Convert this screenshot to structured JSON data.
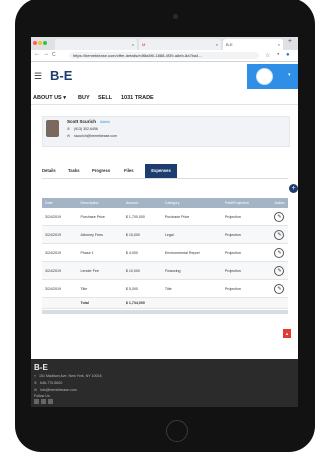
{
  "browser": {
    "tabs": [
      {
        "label": ""
      },
      {
        "label": "M"
      },
      {
        "label": "B-E"
      }
    ],
    "tab_close": "×",
    "new_tab": "+",
    "nav": {
      "back": "←",
      "forward": "→",
      "reload": "C"
    },
    "url": "https://bemebiease.com/offer-details/e4f8a5f0-1888-4f39-a8eb-8a7ba4..."
  },
  "site": {
    "logo": "B-E",
    "menu_icon": "hamburger-icon",
    "nav": [
      "ABOUT US ▾",
      "BUY",
      "SELL",
      "1031 TRADE"
    ]
  },
  "agent": {
    "name": "Scott Scurich",
    "role": "Admin",
    "phone": "(913) 302-6456",
    "email": "sscurich@bemebiease.com"
  },
  "tabs": {
    "items": [
      "Details",
      "Tasks",
      "Progress",
      "Files",
      "Expenses"
    ],
    "selected": "Expenses"
  },
  "add_button": "+",
  "expenses": {
    "columns": [
      "Date",
      "Description",
      "Amount",
      "Category",
      "Paid/Projection",
      "Action"
    ],
    "rows": [
      [
        "3/24/2019",
        "Purchase Price",
        "$ 1,700,000",
        "Purchase Price",
        "Projection"
      ],
      [
        "3/24/2019",
        "Attorney Fees",
        "$ 15,000",
        "Legal",
        "Projection"
      ],
      [
        "3/24/2019",
        "Phase 1",
        "$ 4,000",
        "Environmental Report",
        "Projection"
      ],
      [
        "3/24/2019",
        "Lender Fee",
        "$ 10,000",
        "Financing",
        "Projection"
      ],
      [
        "3/24/2019",
        "Title",
        "$ 5,000",
        "Title",
        "Projection"
      ]
    ],
    "total_label": "Total",
    "total_value": "$ 1,734,000",
    "action_icon": "pencil-icon"
  },
  "footer": {
    "logo": "B-E",
    "address": "151 Madison Ave, New York, NY 10016",
    "phone": "646-770-5620",
    "email": "info@bemebiease.com",
    "follow": "Follow Us"
  },
  "colors": {
    "brand": "#1c3d6e",
    "accent": "#2f8ee5",
    "table_header": "#a4b4c7",
    "footer_bg": "#2b2b2b",
    "danger": "#e53935"
  }
}
